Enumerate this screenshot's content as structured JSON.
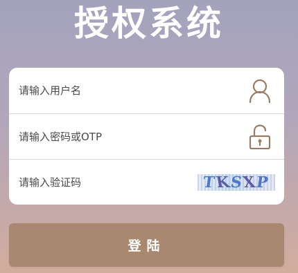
{
  "app": {
    "title": "授权系统"
  },
  "form": {
    "username_placeholder": "请输入用户名",
    "password_placeholder": "请输入密码或OTP",
    "captcha_placeholder": "请输入验证码",
    "captcha_text": [
      "T",
      "K",
      "S",
      "X",
      "P"
    ]
  },
  "icons": {
    "user": "user-icon",
    "lock": "lock-icon"
  },
  "actions": {
    "login_label": "登陆"
  },
  "colors": {
    "accent": "#a98872",
    "icon": "#9b7a62",
    "background_top": "#a3a2bd",
    "background_bottom": "#d2ad9d"
  }
}
